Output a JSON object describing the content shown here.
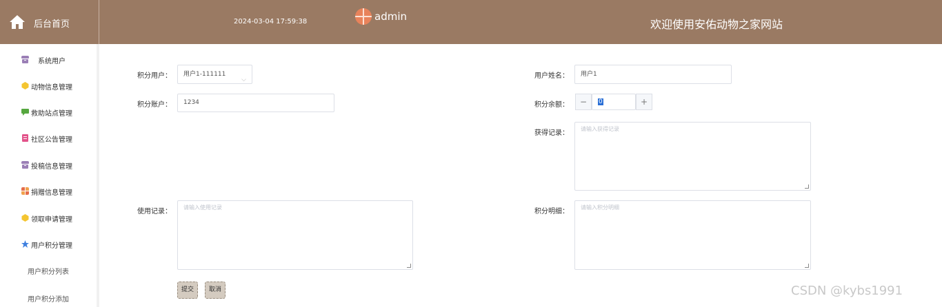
{
  "header": {
    "home_label": "后台首页",
    "datetime": "2024-03-04 17:59:38",
    "username": "admin",
    "welcome": "欢迎使用安佑动物之家网站"
  },
  "sidebar": {
    "items": [
      {
        "label": "系统用户",
        "icon": "archive-icon",
        "color": "#9b7fb6"
      },
      {
        "label": "动物信息管理",
        "icon": "hexagon-icon",
        "color": "#f4c531"
      },
      {
        "label": "救助站点管理",
        "icon": "message-icon",
        "color": "#56a73f"
      },
      {
        "label": "社区公告管理",
        "icon": "document-icon",
        "color": "#e2538a"
      },
      {
        "label": "投稿信息管理",
        "icon": "archive-icon",
        "color": "#9b7fb6"
      },
      {
        "label": "捐赠信息管理",
        "icon": "grid-icon",
        "color": "#e56d4b"
      },
      {
        "label": "领取申请管理",
        "icon": "hexagon-icon",
        "color": "#f4c531"
      },
      {
        "label": "用户积分管理",
        "icon": "star-icon",
        "color": "#3f80df"
      }
    ],
    "subitems": [
      {
        "label": "用户积分列表"
      },
      {
        "label": "用户积分添加"
      }
    ]
  },
  "form": {
    "user_label": "积分用户：",
    "user_value": "用户1-111111",
    "name_label": "用户姓名：",
    "name_value": "用户1",
    "account_label": "积分账户：",
    "account_value": "1234",
    "balance_label": "积分余额：",
    "balance_value": "0",
    "stepper_minus": "−",
    "stepper_plus": "+",
    "earn_label": "获得记录：",
    "earn_placeholder": "请输入获得记录",
    "use_label": "使用记录：",
    "use_placeholder": "请输入使用记录",
    "detail_label": "积分明细：",
    "detail_placeholder": "请输入积分明细",
    "submit_label": "提交",
    "cancel_label": "取消"
  },
  "watermark": "CSDN @kybs1991"
}
